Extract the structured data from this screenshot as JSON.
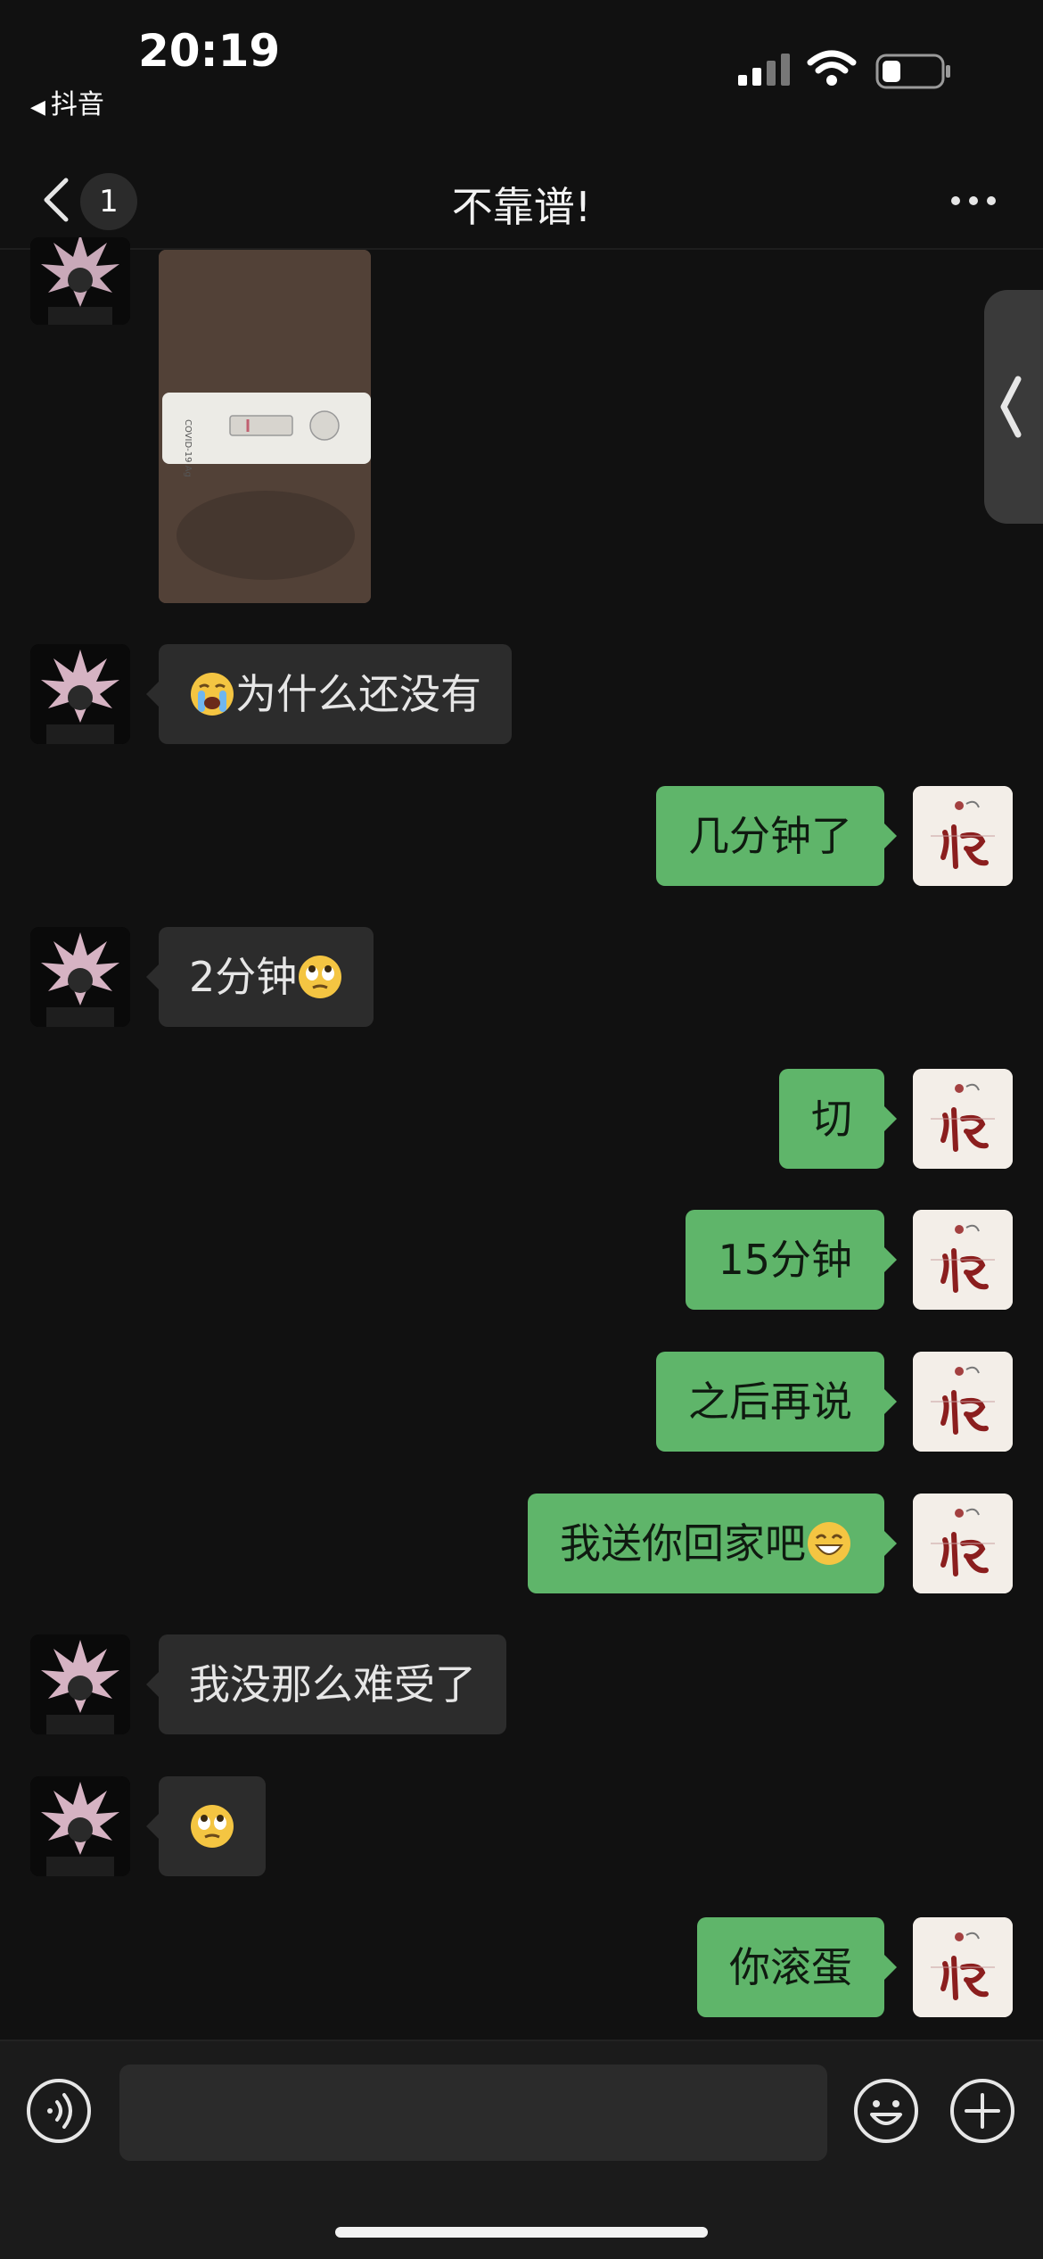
{
  "status_bar": {
    "time": "20:19",
    "back_app": "抖音",
    "icons": [
      "signal-icon",
      "wifi-icon",
      "battery-icon"
    ]
  },
  "nav": {
    "unread_count": "1",
    "title": "不靠谱!",
    "icons": [
      "back-chevron-icon",
      "more-icon"
    ]
  },
  "messages": [
    {
      "side": "left",
      "type": "image",
      "content": "test strip photo",
      "label": "COVID-19 Ag"
    },
    {
      "side": "left",
      "text": "为什么还没有",
      "emoji": "crying-face"
    },
    {
      "side": "right",
      "text": "几分钟了"
    },
    {
      "side": "left",
      "text": "2分钟",
      "emoji": "eye-roll-face"
    },
    {
      "side": "right",
      "text": "切"
    },
    {
      "side": "right",
      "text": "15分钟"
    },
    {
      "side": "right",
      "text": "之后再说"
    },
    {
      "side": "right",
      "text": "我送你回家吧",
      "emoji": "grin-face"
    },
    {
      "side": "left",
      "text": "我没那么难受了"
    },
    {
      "side": "left",
      "text": "",
      "emoji": "eye-roll-face"
    },
    {
      "side": "right",
      "text": "你滚蛋"
    }
  ],
  "avatars": {
    "left": "friend-avatar-anime",
    "right": "user-avatar-calligraphy"
  },
  "input_bar": {
    "icons": [
      "voice-icon",
      "emoji-icon",
      "plus-icon"
    ],
    "placeholder": ""
  },
  "colors": {
    "background": "#111111",
    "bubble_left": "#2c2c2c",
    "bubble_right": "#5fb56a"
  }
}
